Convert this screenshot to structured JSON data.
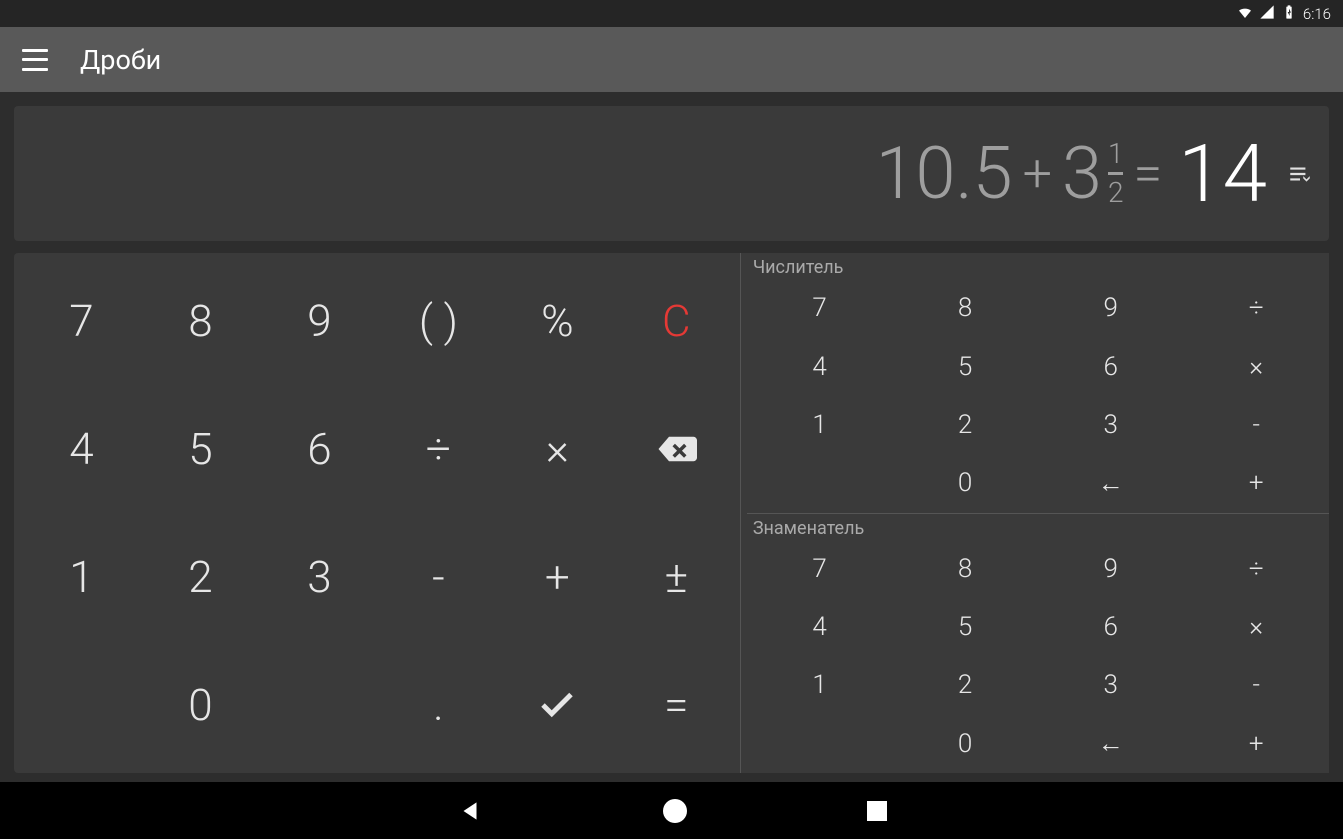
{
  "status": {
    "time": "6:16"
  },
  "app": {
    "title": "Дроби"
  },
  "display": {
    "left_operand": "10.5",
    "operator": "+",
    "mixed_whole": "3",
    "mixed_num": "1",
    "mixed_den": "2",
    "eq": "=",
    "result": "14"
  },
  "main_keys": [
    "7",
    "8",
    "9",
    "( )",
    "%",
    "C",
    "4",
    "5",
    "6",
    "÷",
    "×",
    "⌫",
    "1",
    "2",
    "3",
    "-",
    "+",
    "±",
    "",
    "0",
    "",
    ".",
    "✓",
    "="
  ],
  "numerator": {
    "label": "Числитель",
    "keys": [
      "7",
      "8",
      "9",
      "÷",
      "4",
      "5",
      "6",
      "×",
      "1",
      "2",
      "3",
      "-",
      "",
      "0",
      "←",
      "+"
    ]
  },
  "denominator": {
    "label": "Знаменатель",
    "keys": [
      "7",
      "8",
      "9",
      "÷",
      "4",
      "5",
      "6",
      "×",
      "1",
      "2",
      "3",
      "-",
      "",
      "0",
      "←",
      "+"
    ]
  }
}
